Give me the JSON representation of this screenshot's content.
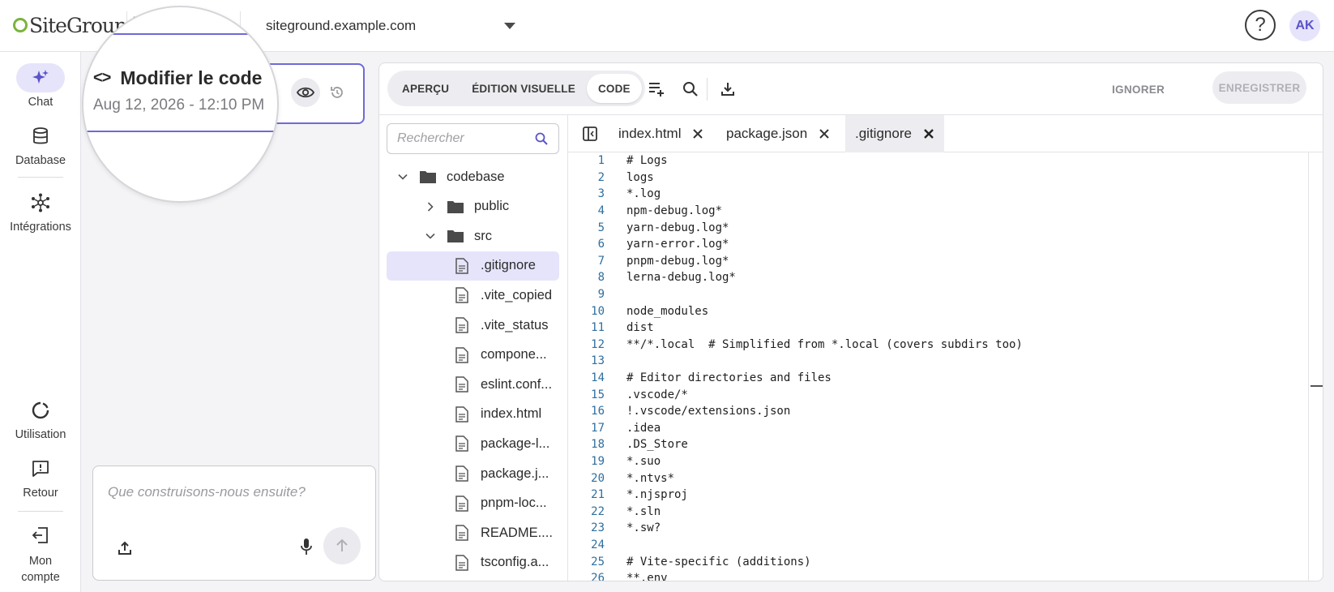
{
  "topbar": {
    "logo_text": "SiteGround",
    "site": "siteground.example.com",
    "help_label": "?",
    "avatar_initials": "AK"
  },
  "nav": {
    "chat": "Chat",
    "database": "Database",
    "integrations": "Intégrations",
    "usage": "Utilisation",
    "feedback": "Retour",
    "account_line1": "Mon",
    "account_line2": "compte"
  },
  "version": {
    "title": "Modifier le code",
    "date": "Aug 12, 2026 - 12:10 PM"
  },
  "composer": {
    "placeholder": "Que construisons-nous ensuite?"
  },
  "toolbar": {
    "tab_preview": "APERÇU",
    "tab_visual": "ÉDITION VISUELLE",
    "tab_code": "CODE",
    "ignore": "IGNORER",
    "save": "ENREGISTRER"
  },
  "tree": {
    "search_placeholder": "Rechercher",
    "items": [
      {
        "label": "codebase",
        "kind": "folder"
      },
      {
        "label": "public",
        "kind": "folder"
      },
      {
        "label": "src",
        "kind": "folder"
      },
      {
        "label": ".gitignore",
        "kind": "file"
      },
      {
        "label": ".vite_copied",
        "kind": "file"
      },
      {
        "label": ".vite_status",
        "kind": "file"
      },
      {
        "label": "compone...",
        "kind": "file"
      },
      {
        "label": "eslint.conf...",
        "kind": "file"
      },
      {
        "label": "index.html",
        "kind": "file"
      },
      {
        "label": "package-l...",
        "kind": "file"
      },
      {
        "label": "package.j...",
        "kind": "file"
      },
      {
        "label": "pnpm-loc...",
        "kind": "file"
      },
      {
        "label": "README....",
        "kind": "file"
      },
      {
        "label": "tsconfig.a...",
        "kind": "file"
      }
    ]
  },
  "tabs": [
    {
      "label": "index.html"
    },
    {
      "label": "package.json"
    },
    {
      "label": ".gitignore"
    }
  ],
  "code_lines": [
    "# Logs",
    "logs",
    "*.log",
    "npm-debug.log*",
    "yarn-debug.log*",
    "yarn-error.log*",
    "pnpm-debug.log*",
    "lerna-debug.log*",
    "",
    "node_modules",
    "dist",
    "**/*.local  # Simplified from *.local (covers subdirs too)",
    "",
    "# Editor directories and files",
    ".vscode/*",
    "!.vscode/extensions.json",
    ".idea",
    ".DS_Store",
    "*.suo",
    "*.ntvs*",
    "*.njsproj",
    "*.sln",
    "*.sw?",
    "",
    "# Vite-specific (additions)",
    "**.env"
  ],
  "colors": {
    "accent": "#6f6ad6",
    "accent_light": "#e6e4fb",
    "logo_green": "#7bb33c"
  }
}
